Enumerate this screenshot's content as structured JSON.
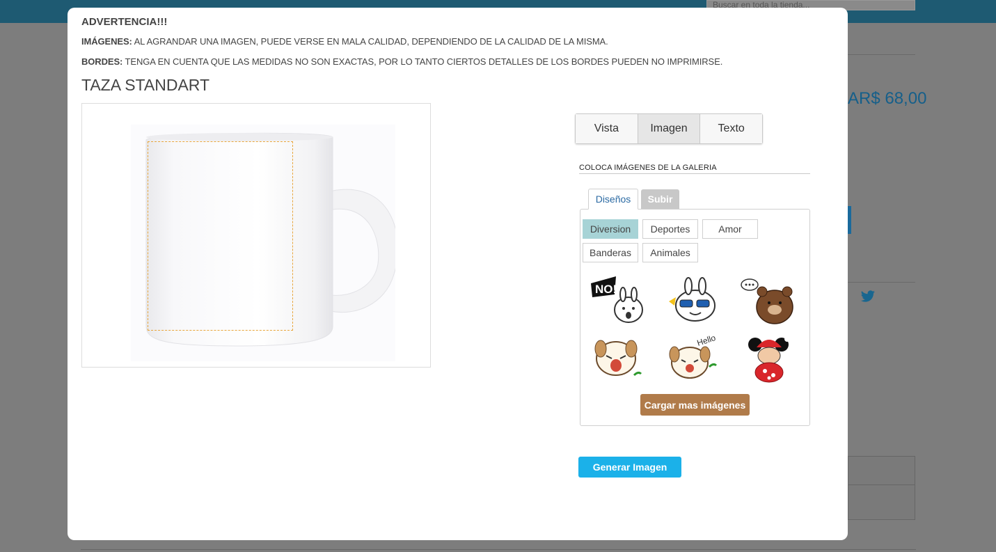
{
  "background": {
    "search_placeholder": "Buscar en toda la tienda...",
    "price": "AR$ 68,00"
  },
  "warning": {
    "title": "ADVERTENCIA!!!",
    "images_label": "IMÁGENES:",
    "images_text": " AL AGRANDAR UNA IMAGEN, PUEDE VERSE EN MALA CALIDAD, DEPENDIENDO DE LA CALIDAD DE LA MISMA.",
    "borders_label": "BORDES:",
    "borders_text": " TENGA EN CUENTA QUE LAS MEDIDAS NO SON EXACTAS, POR LO TANTO CIERTOS DETALLES DE LOS BORDES PUEDEN NO IMPRIMIRSE."
  },
  "product": {
    "title": "TAZA STANDART"
  },
  "tabs": [
    {
      "label": "Vista",
      "active": false
    },
    {
      "label": "Imagen",
      "active": true
    },
    {
      "label": "Texto",
      "active": false
    }
  ],
  "gallery": {
    "label": "COLOCA IMÁGENES DE LA GALERIA",
    "subtabs": {
      "designs": "Diseños",
      "upload": "Subir"
    },
    "categories": [
      {
        "label": "Diversion",
        "active": true
      },
      {
        "label": "Deportes",
        "active": false
      },
      {
        "label": "Amor",
        "active": false
      },
      {
        "label": "Banderas",
        "active": false
      },
      {
        "label": "Animales",
        "active": false
      }
    ],
    "stickers": [
      "no-bunny-sticker",
      "cool-bunny-sticker",
      "brown-bear-sticker",
      "crying-puppy-sticker",
      "hello-puppy-sticker",
      "christmas-mouse-sticker"
    ],
    "sticker_texts": {
      "no": "NO!",
      "hello": "Hello"
    },
    "load_more": "Cargar mas imágenes"
  },
  "generate_button": "Generar Imagen",
  "colors": {
    "accent_blue": "#1bb1e9",
    "load_more_brown": "#b07b4a",
    "active_category": "#a7d3d6",
    "print_area_border": "#e8a53b"
  }
}
